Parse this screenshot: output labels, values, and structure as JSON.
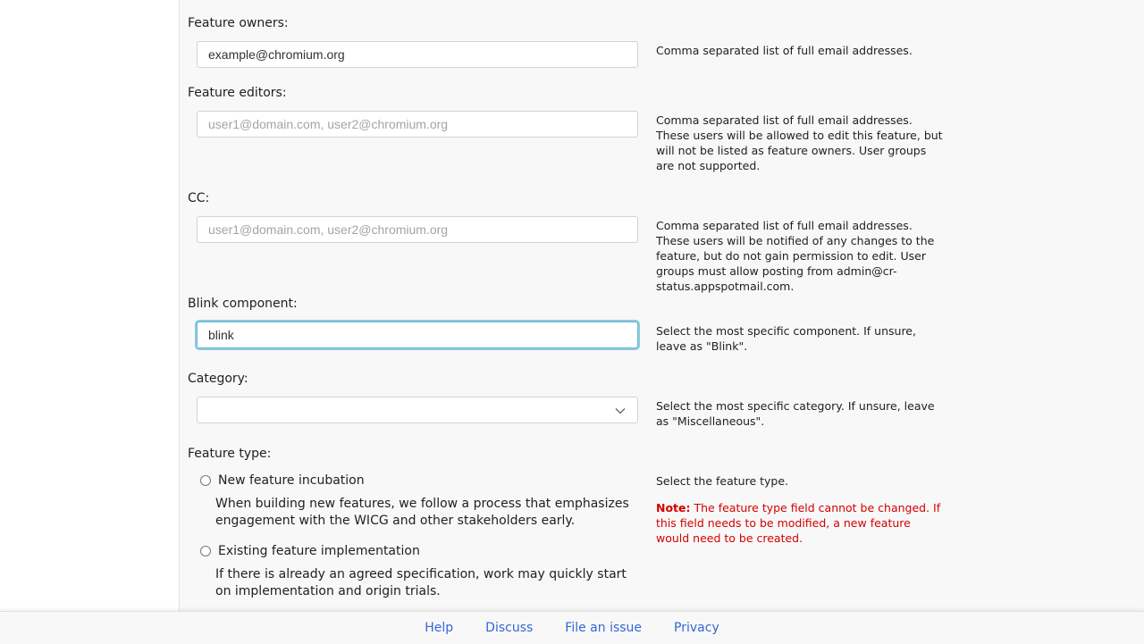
{
  "form": {
    "owners": {
      "label": "Feature owners:",
      "value": "example@chromium.org",
      "placeholder": "",
      "help": "Comma separated list of full email addresses."
    },
    "editors": {
      "label": "Feature editors:",
      "value": "",
      "placeholder": "user1@domain.com, user2@chromium.org",
      "help": "Comma separated list of full email addresses. These users will be allowed to edit this feature, but will not be listed as feature owners. User groups are not supported."
    },
    "cc": {
      "label": "CC:",
      "value": "",
      "placeholder": "user1@domain.com, user2@chromium.org",
      "help": "Comma separated list of full email addresses. These users will be notified of any changes to the feature, but do not gain permission to edit. User groups must allow posting from admin@cr-status.appspotmail.com."
    },
    "blink_component": {
      "label": "Blink component:",
      "value": "blink",
      "help": "Select the most specific component. If unsure, leave as \"Blink\"."
    },
    "category": {
      "label": "Category:",
      "selected": "",
      "help": "Select the most specific category. If unsure, leave as \"Miscellaneous\"."
    },
    "feature_type": {
      "label": "Feature type:",
      "help": "Select the feature type.",
      "note_prefix": "Note:",
      "note_text": " The feature type field cannot be changed. If this field needs to be modified, a new feature would need to be created.",
      "options": [
        {
          "label": "New feature incubation",
          "description": "When building new features, we follow a process that emphasizes engagement with the WICG and other stakeholders early."
        },
        {
          "label": "Existing feature implementation",
          "description": "If there is already an agreed specification, work may quickly start on implementation and origin trials."
        }
      ]
    }
  },
  "footer": {
    "links": [
      "Help",
      "Discuss",
      "File an issue",
      "Privacy"
    ]
  },
  "colors": {
    "note": "#d50000",
    "link": "#3367d6",
    "focus": "#8cc9e3"
  }
}
